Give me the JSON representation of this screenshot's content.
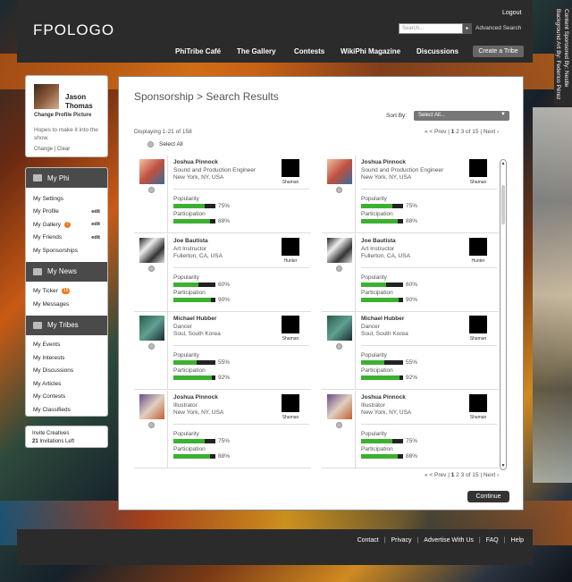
{
  "header": {
    "logo": "FPOLOGO",
    "logout": "Logout",
    "search_placeholder": "Search...",
    "search_button": "▸",
    "advanced_search": "Advanced Search",
    "nav": [
      "PhiTribe Café",
      "The Gallery",
      "Contests",
      "WikiPhi Magazine",
      "Discussions"
    ],
    "create_tribe": "Create a Tribe",
    "credits": "Content Sponsored By: Nestle Background Art By: Federico Pérez"
  },
  "profile": {
    "name_first": "Jason",
    "name_last": "Thomas",
    "change_picture": "Change Profile Picture",
    "status": "Hopes to make it into the show.",
    "change": "Change",
    "clear": "Clear",
    "separator": "|"
  },
  "my_phi": {
    "title": "My Phi",
    "items": [
      {
        "label": "My Settings",
        "edit": ""
      },
      {
        "label": "My Profile",
        "edit": "edit"
      },
      {
        "label": "My Gallery",
        "edit": "edit",
        "badge": "7"
      },
      {
        "label": "My Friends",
        "edit": "edit"
      },
      {
        "label": "My Sponsorships",
        "edit": ""
      }
    ]
  },
  "my_news": {
    "title": "My News",
    "items": [
      {
        "label": "My Ticker",
        "badge": "15"
      },
      {
        "label": "My Messages"
      }
    ]
  },
  "my_tribes": {
    "title": "My Tribes",
    "items": [
      "My Events",
      "My Interests",
      "My Discussions",
      "My Articles",
      "My Contests",
      "My Classifieds"
    ]
  },
  "invite": {
    "title": "Invite Creatives",
    "count": "21",
    "left_label": "Invitations Left"
  },
  "main": {
    "title": "Sponsorship > Search Results",
    "sort_label": "Sort By:",
    "sort_value": "Select All...",
    "sort_arrow": "▼",
    "display_count": "Displaying 1-21 of 158",
    "select_all": "Select All",
    "pager": {
      "prev": "« < Prev",
      "sep1": "|",
      "p1": "1",
      "p2": "2",
      "p3": "3",
      "of": "of 15",
      "sep2": "|",
      "next": "Next ›"
    },
    "continue": "Continue",
    "popularity_label": "Popularity",
    "participation_label": "Participation"
  },
  "results": [
    {
      "name": "Joshua Pinnock",
      "role": "Sound and Production Engineer",
      "location": "New York, NY, USA",
      "rank": "Shaman",
      "popularity": 75,
      "popularity_text": "75%",
      "participation": 88,
      "participation_text": "88%"
    },
    {
      "name": "Joshua Pinnock",
      "role": "Sound and Production Engineer",
      "location": "New York, NY, USA",
      "rank": "Shaman",
      "popularity": 75,
      "popularity_text": "75%",
      "participation": 88,
      "participation_text": "88%"
    },
    {
      "name": "Joe Bautista",
      "role": "Art Instructor",
      "location": "Fullerton, CA, USA",
      "rank": "Hunter",
      "popularity": 60,
      "popularity_text": "60%",
      "participation": 90,
      "participation_text": "90%"
    },
    {
      "name": "Joe Bautista",
      "role": "Art Instructor",
      "location": "Fullerton, CA, USA",
      "rank": "Hunter",
      "popularity": 60,
      "popularity_text": "60%",
      "participation": 90,
      "participation_text": "90%"
    },
    {
      "name": "Michael Hubber",
      "role": "Dancer",
      "location": "Soul, South Korea",
      "rank": "Shaman",
      "popularity": 55,
      "popularity_text": "55%",
      "participation": 92,
      "participation_text": "92%"
    },
    {
      "name": "Michael Hubber",
      "role": "Dancer",
      "location": "Soul, South Korea",
      "rank": "Shaman",
      "popularity": 55,
      "popularity_text": "55%",
      "participation": 92,
      "participation_text": "92%"
    },
    {
      "name": "Joshua Pinnock",
      "role": "Illustrator",
      "location": "New York, NY, USA",
      "rank": "Shaman",
      "popularity": 75,
      "popularity_text": "75%",
      "participation": 88,
      "participation_text": "88%"
    },
    {
      "name": "Joshua Pinnock",
      "role": "Illustrator",
      "location": "New York, NY, USA",
      "rank": "Shaman",
      "popularity": 75,
      "popularity_text": "75%",
      "participation": 88,
      "participation_text": "88%"
    }
  ],
  "footer": {
    "links": [
      "Contact",
      "Privacy",
      "Advertise With Us",
      "FAQ",
      "Help"
    ],
    "separator": "|"
  },
  "colors": {
    "bar_fill": "#3cb030",
    "chrome": "#2b2b2b",
    "badge": "#e87a20"
  }
}
